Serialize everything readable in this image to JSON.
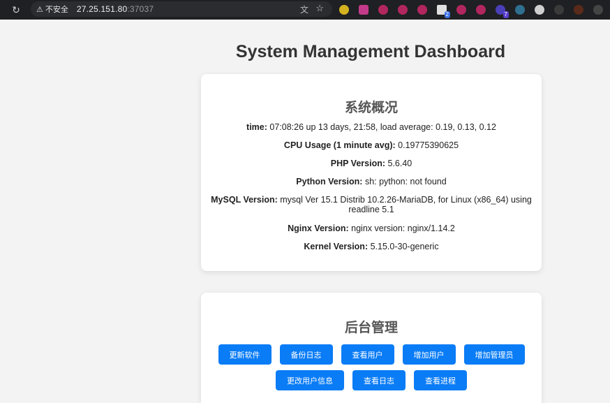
{
  "browser": {
    "security_label": "不安全",
    "url_host": "27.25.151.80",
    "url_port": ":37037",
    "extension_badges": [
      "2",
      "7"
    ]
  },
  "page": {
    "title": "System Management Dashboard"
  },
  "overview": {
    "heading": "系统概况",
    "items": [
      {
        "label": "time:",
        "value": "07:08:26 up 13 days, 21:58, load average: 0.19, 0.13, 0.12"
      },
      {
        "label": "CPU Usage (1 minute avg):",
        "value": "0.19775390625"
      },
      {
        "label": "PHP Version:",
        "value": "5.6.40"
      },
      {
        "label": "Python Version:",
        "value": "sh: python: not found"
      },
      {
        "label": "MySQL Version:",
        "value": "mysql Ver 15.1 Distrib 10.2.26-MariaDB, for Linux (x86_64) using readline 5.1"
      },
      {
        "label": "Nginx Version:",
        "value": "nginx version: nginx/1.14.2"
      },
      {
        "label": "Kernel Version:",
        "value": "5.15.0-30-generic"
      }
    ]
  },
  "admin": {
    "heading": "后台管理",
    "buttons": [
      "更新软件",
      "备份日志",
      "查看用户",
      "增加用户",
      "增加管理员",
      "更改用户信息",
      "查看日志",
      "查看进程"
    ]
  },
  "colors": {
    "button": "#0a7cf6",
    "background": "#f3f3f3",
    "card": "#ffffff"
  }
}
